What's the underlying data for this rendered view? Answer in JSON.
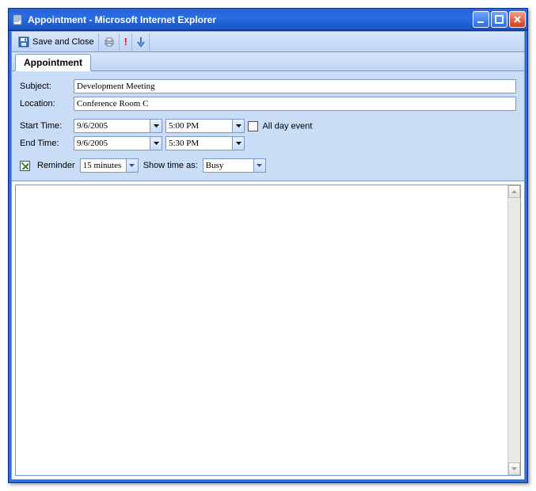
{
  "window": {
    "title": "Appointment - Microsoft Internet Explorer"
  },
  "toolbar": {
    "save_label": "Save and Close"
  },
  "tab": {
    "label": "Appointment"
  },
  "form": {
    "subject_label": "Subject:",
    "subject_value": "Development Meeting",
    "location_label": "Location:",
    "location_value": "Conference Room C",
    "start_label": "Start Time:",
    "start_date": "9/6/2005",
    "start_time": "5:00 PM",
    "end_label": "End Time:",
    "end_date": "9/6/2005",
    "end_time": "5:30 PM",
    "allday_label": "All day event",
    "allday_checked": false,
    "reminder_label": "Reminder",
    "reminder_checked": true,
    "reminder_value": "15 minutes",
    "showas_label": "Show time as:",
    "showas_value": "Busy"
  }
}
